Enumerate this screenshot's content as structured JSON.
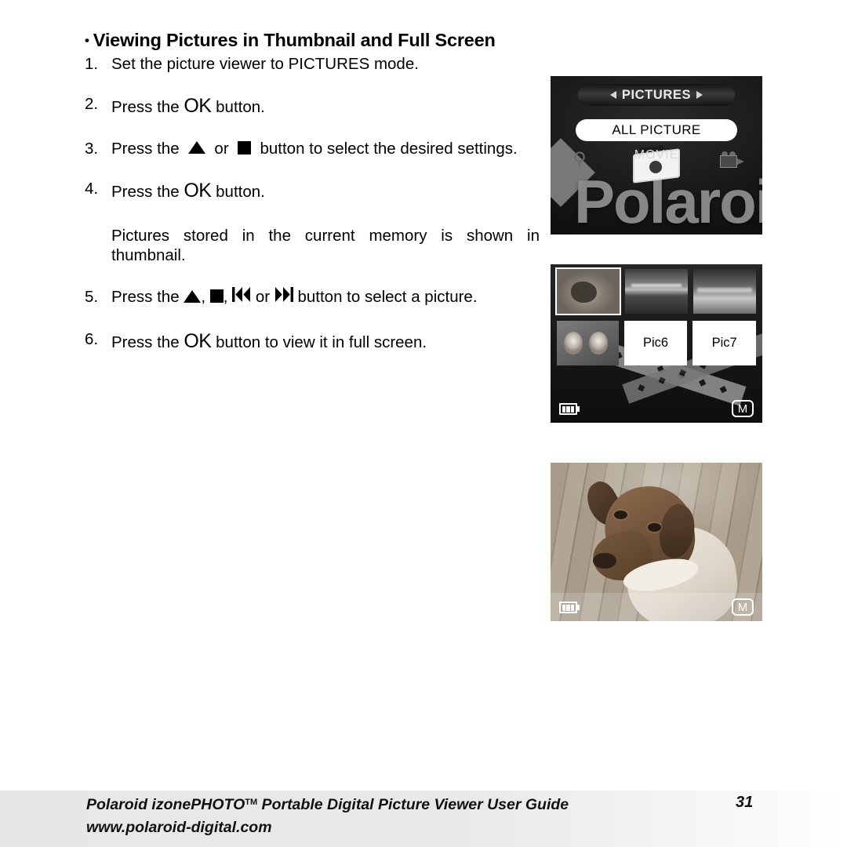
{
  "heading": {
    "bullet": "•",
    "text": "Viewing Pictures in Thumbnail and Full Screen"
  },
  "steps": [
    {
      "num": "1.",
      "text_before": "Set the picture viewer to PICTURES mode.",
      "icons": []
    },
    {
      "num": "2.",
      "text_before": "Press the",
      "ok": "OK",
      "text_after": "button."
    },
    {
      "num": "3.",
      "text_before": "Press the",
      "icon_a": "up-triangle-icon",
      "joiner": "or",
      "icon_b": "stop-square-icon",
      "text_after": "button to select the desired settings."
    },
    {
      "num": "4.",
      "text_before": "Press the",
      "ok": "OK",
      "text_after": "button."
    },
    {
      "num": "",
      "text_before": "Pictures stored in the current memory is shown in thumbnail."
    },
    {
      "num": "5.",
      "text_before": "Press the",
      "icon_a": "up-triangle-icon",
      "icon_b": "stop-square-icon",
      "icon_c": "previous-track-icon",
      "joiner": "or",
      "icon_d": "next-track-icon",
      "text_after": "button to select a picture."
    },
    {
      "num": "6.",
      "text_before": "Press the",
      "ok": "OK",
      "text_after": "button to view it in full screen."
    }
  ],
  "screens": {
    "menu": {
      "title": "PICTURES",
      "left_arrow": "left-arrow-icon",
      "right_arrow": "right-arrow-icon",
      "selected_option": "ALL PICTURE",
      "mode_label": "MOVIE",
      "brand_watermark": "Polaroid",
      "icons": [
        "zoom-icon",
        "camera-icon",
        "movie-camera-icon"
      ]
    },
    "thumbnails": {
      "rows": [
        [
          {
            "kind": "image",
            "art": "dog",
            "selected": true,
            "label": ""
          },
          {
            "kind": "image",
            "art": "night1",
            "selected": false,
            "label": ""
          },
          {
            "kind": "image",
            "art": "night2",
            "selected": false,
            "label": ""
          }
        ],
        [
          {
            "kind": "image",
            "art": "kids",
            "selected": false,
            "label": ""
          },
          {
            "kind": "label",
            "art": "",
            "selected": false,
            "label": "Pic6"
          },
          {
            "kind": "label",
            "art": "",
            "selected": false,
            "label": "Pic7"
          }
        ]
      ],
      "battery_icon": "battery-icon",
      "memory_badge": "M"
    },
    "fullscreen": {
      "subject": "dog-photo",
      "battery_icon": "battery-icon",
      "memory_badge": "M"
    }
  },
  "footer": {
    "line1_a": "Polaroid izonePHOTO",
    "trademark": "TM",
    "line1_b": " Portable Digital Picture Viewer User Guide",
    "line2": "www.polaroid-digital.com",
    "page_number": "31"
  }
}
